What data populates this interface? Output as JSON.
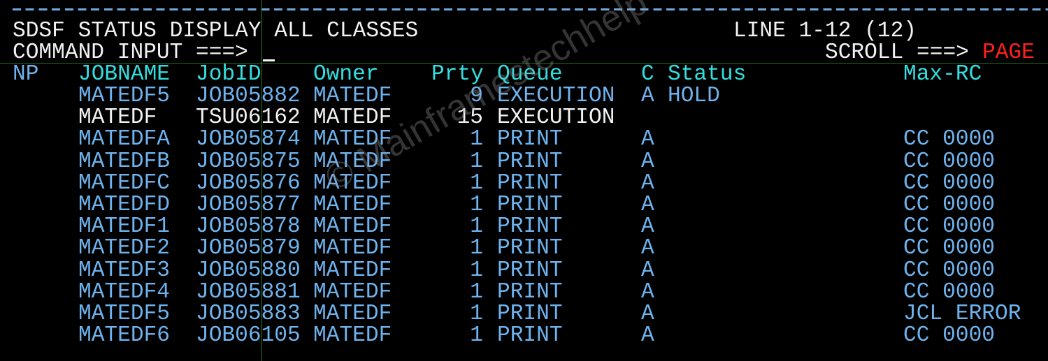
{
  "header": {
    "title": "SDSF STATUS DISPLAY ALL CLASSES",
    "line_info": "LINE 1-12 (12)",
    "command_label": "COMMAND INPUT ===>",
    "command_value": "",
    "scroll_label": "SCROLL ===>",
    "scroll_value": "PAGE"
  },
  "columns": {
    "np": "NP",
    "jobname": "JOBNAME",
    "jobid": "JobID",
    "owner": "Owner",
    "prty": "Prty",
    "queue": "Queue",
    "c": "C",
    "status": "Status",
    "maxrc": "Max-RC"
  },
  "rows": [
    {
      "np": "",
      "jobname": "MATEDF5",
      "jobid": "JOB05882",
      "owner": "MATEDF",
      "prty": "9",
      "queue": "EXECUTION",
      "c": "A",
      "status": "HOLD",
      "maxrc": "",
      "highlight": false
    },
    {
      "np": "",
      "jobname": "MATEDF",
      "jobid": "TSU06162",
      "owner": "MATEDF",
      "prty": "15",
      "queue": "EXECUTION",
      "c": "",
      "status": "",
      "maxrc": "",
      "highlight": true
    },
    {
      "np": "",
      "jobname": "MATEDFA",
      "jobid": "JOB05874",
      "owner": "MATEDF",
      "prty": "1",
      "queue": "PRINT",
      "c": "A",
      "status": "",
      "maxrc": "CC 0000",
      "highlight": false
    },
    {
      "np": "",
      "jobname": "MATEDFB",
      "jobid": "JOB05875",
      "owner": "MATEDF",
      "prty": "1",
      "queue": "PRINT",
      "c": "A",
      "status": "",
      "maxrc": "CC 0000",
      "highlight": false
    },
    {
      "np": "",
      "jobname": "MATEDFC",
      "jobid": "JOB05876",
      "owner": "MATEDF",
      "prty": "1",
      "queue": "PRINT",
      "c": "A",
      "status": "",
      "maxrc": "CC 0000",
      "highlight": false
    },
    {
      "np": "",
      "jobname": "MATEDFD",
      "jobid": "JOB05877",
      "owner": "MATEDF",
      "prty": "1",
      "queue": "PRINT",
      "c": "A",
      "status": "",
      "maxrc": "CC 0000",
      "highlight": false
    },
    {
      "np": "",
      "jobname": "MATEDF1",
      "jobid": "JOB05878",
      "owner": "MATEDF",
      "prty": "1",
      "queue": "PRINT",
      "c": "A",
      "status": "",
      "maxrc": "CC 0000",
      "highlight": false
    },
    {
      "np": "",
      "jobname": "MATEDF2",
      "jobid": "JOB05879",
      "owner": "MATEDF",
      "prty": "1",
      "queue": "PRINT",
      "c": "A",
      "status": "",
      "maxrc": "CC 0000",
      "highlight": false
    },
    {
      "np": "",
      "jobname": "MATEDF3",
      "jobid": "JOB05880",
      "owner": "MATEDF",
      "prty": "1",
      "queue": "PRINT",
      "c": "A",
      "status": "",
      "maxrc": "CC 0000",
      "highlight": false
    },
    {
      "np": "",
      "jobname": "MATEDF4",
      "jobid": "JOB05881",
      "owner": "MATEDF",
      "prty": "1",
      "queue": "PRINT",
      "c": "A",
      "status": "",
      "maxrc": "CC 0000",
      "highlight": false
    },
    {
      "np": "",
      "jobname": "MATEDF5",
      "jobid": "JOB05883",
      "owner": "MATEDF",
      "prty": "1",
      "queue": "PRINT",
      "c": "A",
      "status": "",
      "maxrc": "JCL ERROR",
      "highlight": false
    },
    {
      "np": "",
      "jobname": "MATEDF6",
      "jobid": "JOB06105",
      "owner": "MATEDF",
      "prty": "1",
      "queue": "PRINT",
      "c": "A",
      "status": "",
      "maxrc": "CC 0000",
      "highlight": false
    }
  ],
  "watermark": "© Mainframestechhelp"
}
